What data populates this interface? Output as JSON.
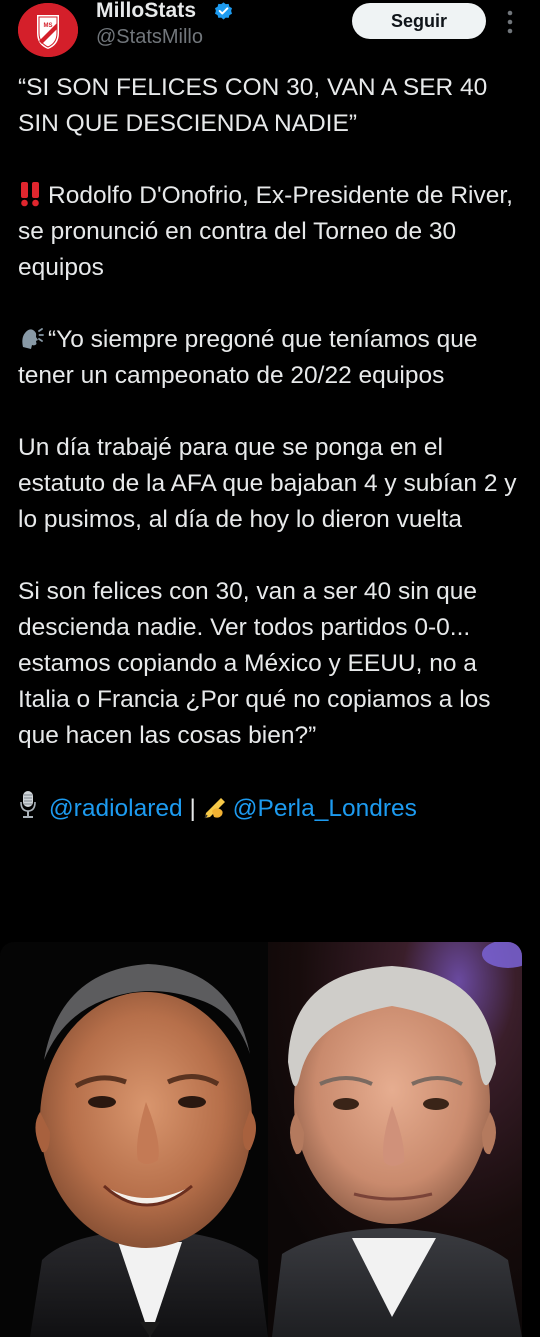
{
  "author": {
    "name": "MilloStats",
    "handle": "@StatsMillo",
    "verified_icon": "verified-badge-icon",
    "avatar_icon": "river-shield-avatar"
  },
  "follow_button": {
    "label": "Seguir"
  },
  "menu": {
    "icon": "more-options-icon"
  },
  "tweet": {
    "headline": "“SI SON FELICES CON 30, VAN A SER 40 SIN QUE DESCIENDA NADIE”",
    "intro_emoji": "double-exclamation-icon",
    "intro": "Rodolfo D'Onofrio, Ex-Presidente de River,  se pronunció en contra del Torneo de 30 equipos",
    "quote_emoji": "speaking-head-icon",
    "quote_1": "“Yo siempre pregoné que teníamos que tener un campeonato de 20/22 equipos",
    "quote_2": "Un día trabajé para que se ponga en el estatuto de la AFA que bajaban 4 y subían 2 y lo pusimos, al día de hoy lo dieron vuelta",
    "quote_3": "Si son felices con 30, van a ser 40 sin que descienda nadie. Ver todos partidos 0-0... estamos copiando a México y EEUU, no a Italia o Francia ¿Por qué no copiamos a los que hacen las cosas bien?”",
    "credit_mic_emoji": "studio-microphone-icon",
    "credit_mention_1": "@radiolared",
    "credit_separator": "|",
    "credit_writing_emoji": "writing-hand-icon",
    "credit_mention_2": "@Perla_Londres"
  },
  "media": {
    "description_icon": "two-portraits-photo"
  },
  "colors": {
    "background": "#000000",
    "text": "#e7e9ea",
    "secondary_text": "#71767b",
    "link": "#1d9bf0",
    "verified": "#1d9bf0",
    "avatar_red": "#d41f2a"
  }
}
